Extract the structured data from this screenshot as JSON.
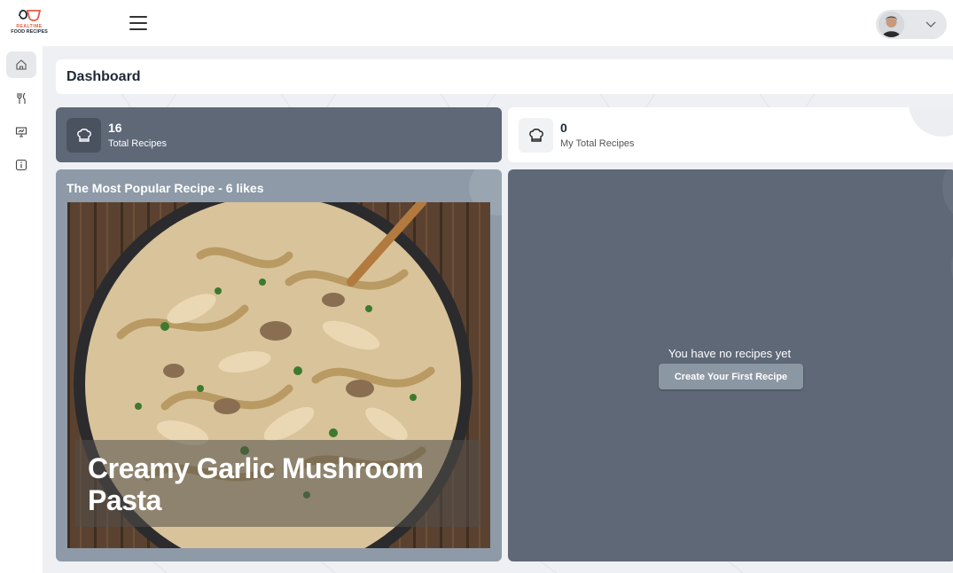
{
  "app": {
    "logo_line1": "REALTIME",
    "logo_line2": "FOOD RECIPES"
  },
  "header": {
    "menu_icon": "hamburger-menu-icon",
    "profile_icon": "user-avatar",
    "dropdown_icon": "chevron-down-icon"
  },
  "sidebar": {
    "items": [
      {
        "icon": "home-icon",
        "active": true
      },
      {
        "icon": "fork-knife-icon",
        "active": false
      },
      {
        "icon": "presentation-icon",
        "active": false
      },
      {
        "icon": "info-icon",
        "active": false
      }
    ]
  },
  "page": {
    "title": "Dashboard"
  },
  "stats": [
    {
      "value": "16",
      "label": "Total Recipes",
      "icon": "chef-hat-icon"
    },
    {
      "value": "0",
      "label": "My Total Recipes",
      "icon": "chef-hat-icon"
    }
  ],
  "popular": {
    "title": "The Most Popular Recipe - 6 likes",
    "recipe_name": "Creamy Garlic Mushroom Pasta"
  },
  "my_recipes": {
    "empty_message": "You have no recipes yet",
    "create_button": "Create Your First Recipe"
  },
  "colors": {
    "dark_card": "#5e6877",
    "popular_card": "#8e9aa8",
    "button": "#8c97a4",
    "logo_accent": "#e25b45"
  }
}
